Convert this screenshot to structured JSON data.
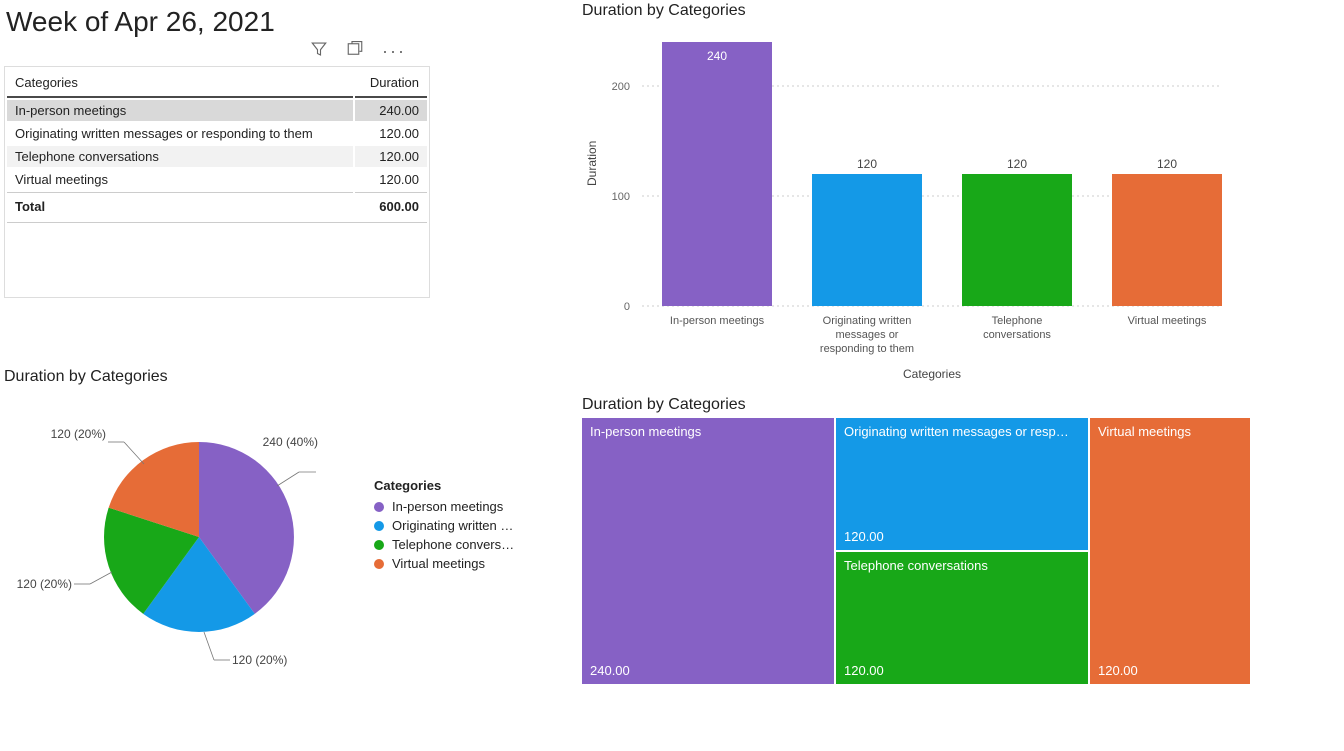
{
  "title": "Week of Apr 26, 2021",
  "table": {
    "headers": [
      "Categories",
      "Duration"
    ],
    "rows": [
      {
        "cat": "In-person meetings",
        "dur": "240.00",
        "selected": true
      },
      {
        "cat": "Originating written messages or responding to them",
        "dur": "120.00"
      },
      {
        "cat": "Telephone conversations",
        "dur": "120.00"
      },
      {
        "cat": "Virtual meetings",
        "dur": "120.00"
      }
    ],
    "total_label": "Total",
    "total_value": "600.00"
  },
  "colors": {
    "inperson": "#8661C5",
    "written": "#1499E7",
    "phone": "#18A818",
    "virtual": "#E66C37"
  },
  "bar": {
    "title": "Duration by Categories",
    "ylabel": "Duration",
    "xlabel": "Categories",
    "ticks": [
      0,
      100,
      200
    ]
  },
  "pie": {
    "title": "Duration by Categories",
    "legend_header": "Categories",
    "legend": [
      "In-person meetings",
      "Originating written …",
      "Telephone convers…",
      "Virtual meetings"
    ],
    "labels": [
      "240 (40%)",
      "120 (20%)",
      "120 (20%)",
      "120 (20%)"
    ]
  },
  "tree": {
    "title": "Duration by Categories",
    "cells": [
      {
        "label": "In-person meetings",
        "value": "240.00"
      },
      {
        "label": "Originating written messages or resp…",
        "value": "120.00"
      },
      {
        "label": "Telephone conversations",
        "value": "120.00"
      },
      {
        "label": "Virtual meetings",
        "value": "120.00"
      }
    ]
  },
  "chart_data": {
    "type": "dashboard",
    "series_colors": {
      "In-person meetings": "#8661C5",
      "Originating written messages or responding to them": "#1499E7",
      "Telephone conversations": "#18A818",
      "Virtual meetings": "#E66C37"
    },
    "charts": [
      {
        "type": "table",
        "title": "Week of Apr 26, 2021",
        "columns": [
          "Categories",
          "Duration"
        ],
        "rows": [
          [
            "In-person meetings",
            240.0
          ],
          [
            "Originating written messages or responding to them",
            120.0
          ],
          [
            "Telephone conversations",
            120.0
          ],
          [
            "Virtual meetings",
            120.0
          ]
        ],
        "total": 600.0
      },
      {
        "type": "bar",
        "title": "Duration by Categories",
        "xlabel": "Categories",
        "ylabel": "Duration",
        "ylim": [
          0,
          240
        ],
        "categories": [
          "In-person meetings",
          "Originating written messages or responding to them",
          "Telephone conversations",
          "Virtual meetings"
        ],
        "values": [
          240,
          120,
          120,
          120
        ]
      },
      {
        "type": "pie",
        "title": "Duration by Categories",
        "categories": [
          "In-person meetings",
          "Originating written messages or responding to them",
          "Telephone conversations",
          "Virtual meetings"
        ],
        "values": [
          240,
          120,
          120,
          120
        ],
        "percentages": [
          40,
          20,
          20,
          20
        ]
      },
      {
        "type": "treemap",
        "title": "Duration by Categories",
        "categories": [
          "In-person meetings",
          "Originating written messages or responding to them",
          "Telephone conversations",
          "Virtual meetings"
        ],
        "values": [
          240.0,
          120.0,
          120.0,
          120.0
        ]
      }
    ]
  }
}
